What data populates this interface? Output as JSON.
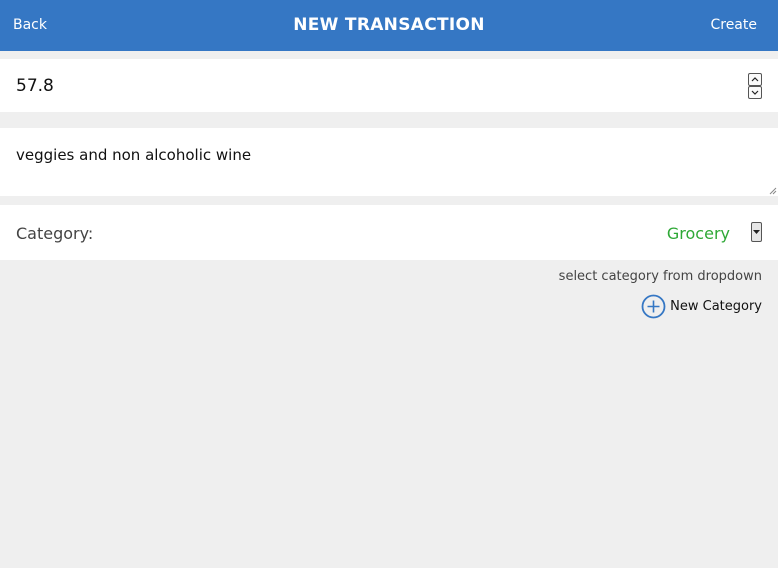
{
  "header": {
    "back_label": "Back",
    "title": "NEW TRANSACTION",
    "create_label": "Create",
    "color": "#3577c4"
  },
  "form": {
    "amount_value": "57.8",
    "description_value": "veggies and non alcoholic wine",
    "category_label": "Category:",
    "category_selected": "Grocery",
    "category_color": "#2ea836",
    "hint": "select category from dropdown",
    "new_category_label": "New Category"
  },
  "icons": {
    "spinner_up": "chevron-up-icon",
    "spinner_down": "chevron-down-icon",
    "dropdown": "caret-down-icon",
    "new_category": "plus-circle-icon",
    "resize": "resize-handle-icon"
  }
}
